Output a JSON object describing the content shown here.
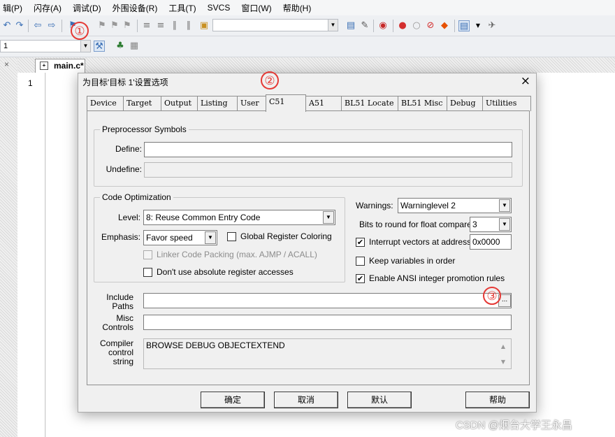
{
  "menubar": {
    "items": [
      "辑(P)",
      "闪存(A)",
      "调试(D)",
      "外围设备(R)",
      "工具(T)",
      "SVCS",
      "窗口(W)",
      "帮助(H)"
    ]
  },
  "target_combo": {
    "value": "1"
  },
  "editor": {
    "tab_label": "main.c*",
    "line_number": "1"
  },
  "dialog": {
    "title": "为目标'目标 1'设置选项",
    "close": "×",
    "tabs": [
      "Device",
      "Target",
      "Output",
      "Listing",
      "User",
      "C51",
      "A51",
      "BL51 Locate",
      "BL51 Misc",
      "Debug",
      "Utilities"
    ],
    "active_tab": "C51",
    "preprocessor": {
      "group_title": "Preprocessor Symbols",
      "define_label": "Define:",
      "define_value": "",
      "undefine_label": "Undefine:",
      "undefine_value": ""
    },
    "code_optimization": {
      "group_title": "Code Optimization",
      "level_label": "Level:",
      "level_value": "8: Reuse Common Entry Code",
      "emphasis_label": "Emphasis:",
      "emphasis_value": "Favor speed",
      "global_register_coloring": {
        "label": "Global Register Coloring",
        "checked": false
      },
      "linker_code_packing": {
        "label": "Linker Code Packing (max. AJMP / ACALL)",
        "checked": false,
        "disabled": true
      },
      "no_absolute_register": {
        "label": "Don't use absolute register accesses",
        "checked": false
      }
    },
    "warnings": {
      "label": "Warnings:",
      "value": "Warninglevel 2",
      "bits_label": "Bits to round for float compare:",
      "bits_value": "3",
      "interrupt_vectors": {
        "label": "Interrupt vectors at address:",
        "checked": true,
        "value": "0x0000"
      },
      "keep_variables": {
        "label": "Keep variables in order",
        "checked": false
      },
      "ansi_promotion": {
        "label": "Enable ANSI integer promotion rules",
        "checked": true
      }
    },
    "include_paths": {
      "label_line1": "Include",
      "label_line2": "Paths",
      "value": "",
      "browse": "..."
    },
    "misc_controls": {
      "label_line1": "Misc",
      "label_line2": "Controls",
      "value": ""
    },
    "compiler_string": {
      "label_line1": "Compiler",
      "label_line2": "control",
      "label_line3": "string",
      "value": "BROWSE DEBUG OBJECTEXTEND"
    },
    "buttons": {
      "ok": "确定",
      "cancel": "取消",
      "defaults": "默认",
      "help": "帮助"
    }
  },
  "callouts": [
    "①",
    "②",
    "③"
  ],
  "watermark": "CSDN @烟台大学王永昌",
  "colors": {
    "callout": "#e53935",
    "dialog_bg": "#f0f0f0"
  }
}
